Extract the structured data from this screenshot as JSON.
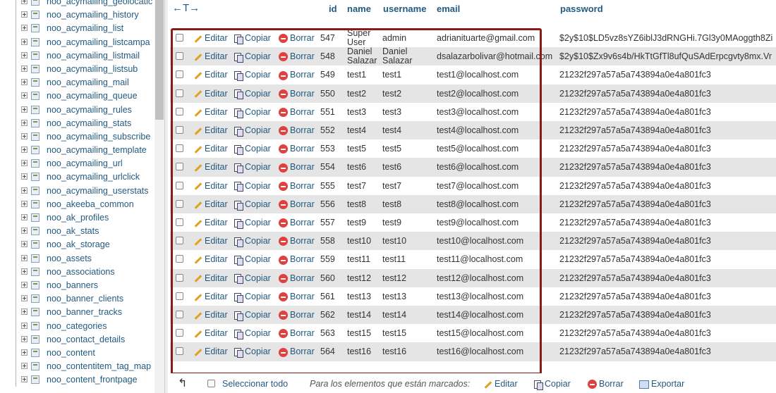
{
  "sidebar": {
    "tables": [
      "noo_acymailing_geolocatic",
      "noo_acymailing_history",
      "noo_acymailing_list",
      "noo_acymailing_listcampa",
      "noo_acymailing_listmail",
      "noo_acymailing_listsub",
      "noo_acymailing_mail",
      "noo_acymailing_queue",
      "noo_acymailing_rules",
      "noo_acymailing_stats",
      "noo_acymailing_subscribe",
      "noo_acymailing_template",
      "noo_acymailing_url",
      "noo_acymailing_urlclick",
      "noo_acymailing_userstats",
      "noo_akeeba_common",
      "noo_ak_profiles",
      "noo_ak_stats",
      "noo_ak_storage",
      "noo_assets",
      "noo_associations",
      "noo_banners",
      "noo_banner_clients",
      "noo_banner_tracks",
      "noo_categories",
      "noo_contact_details",
      "noo_content",
      "noo_contentitem_tag_map",
      "noo_content_frontpage"
    ]
  },
  "table": {
    "arrows": "←T→",
    "columns": {
      "id": "id",
      "name": "name",
      "username": "username",
      "email": "email",
      "password": "password"
    },
    "actions": {
      "edit": "Editar",
      "copy": "Copiar",
      "delete": "Borrar"
    },
    "rows": [
      {
        "id": "547",
        "name": [
          "Super",
          "User"
        ],
        "username": [
          "admin"
        ],
        "email": "adrianituarte@gmail.com",
        "password": "$2y$10$LD5vz8sYZ6iblJ3dRNGHi.7Gl3y0MAoggth8Zi"
      },
      {
        "id": "548",
        "name": [
          "Daniel",
          "Salazar"
        ],
        "username": [
          "Daniel",
          "Salazar"
        ],
        "email": "dsalazarbolivar@hotmail.com",
        "password": "$2y$10$Zx9v6s4b/HkTtGfTl8ufQuSAdErpcgvty8mx.Vr"
      },
      {
        "id": "549",
        "name": [
          "test1"
        ],
        "username": [
          "test1"
        ],
        "email": "test1@localhost.com",
        "password": "21232f297a57a5a743894a0e4a801fc3"
      },
      {
        "id": "550",
        "name": [
          "test2"
        ],
        "username": [
          "test2"
        ],
        "email": "test2@localhost.com",
        "password": "21232f297a57a5a743894a0e4a801fc3"
      },
      {
        "id": "551",
        "name": [
          "test3"
        ],
        "username": [
          "test3"
        ],
        "email": "test3@localhost.com",
        "password": "21232f297a57a5a743894a0e4a801fc3"
      },
      {
        "id": "552",
        "name": [
          "test4"
        ],
        "username": [
          "test4"
        ],
        "email": "test4@localhost.com",
        "password": "21232f297a57a5a743894a0e4a801fc3"
      },
      {
        "id": "553",
        "name": [
          "test5"
        ],
        "username": [
          "test5"
        ],
        "email": "test5@localhost.com",
        "password": "21232f297a57a5a743894a0e4a801fc3"
      },
      {
        "id": "554",
        "name": [
          "test6"
        ],
        "username": [
          "test6"
        ],
        "email": "test6@localhost.com",
        "password": "21232f297a57a5a743894a0e4a801fc3"
      },
      {
        "id": "555",
        "name": [
          "test7"
        ],
        "username": [
          "test7"
        ],
        "email": "test7@localhost.com",
        "password": "21232f297a57a5a743894a0e4a801fc3"
      },
      {
        "id": "556",
        "name": [
          "test8"
        ],
        "username": [
          "test8"
        ],
        "email": "test8@localhost.com",
        "password": "21232f297a57a5a743894a0e4a801fc3"
      },
      {
        "id": "557",
        "name": [
          "test9"
        ],
        "username": [
          "test9"
        ],
        "email": "test9@localhost.com",
        "password": "21232f297a57a5a743894a0e4a801fc3"
      },
      {
        "id": "558",
        "name": [
          "test10"
        ],
        "username": [
          "test10"
        ],
        "email": "test10@localhost.com",
        "password": "21232f297a57a5a743894a0e4a801fc3"
      },
      {
        "id": "559",
        "name": [
          "test11"
        ],
        "username": [
          "test11"
        ],
        "email": "test11@localhost.com",
        "password": "21232f297a57a5a743894a0e4a801fc3"
      },
      {
        "id": "560",
        "name": [
          "test12"
        ],
        "username": [
          "test12"
        ],
        "email": "test12@localhost.com",
        "password": "21232f297a57a5a743894a0e4a801fc3"
      },
      {
        "id": "561",
        "name": [
          "test13"
        ],
        "username": [
          "test13"
        ],
        "email": "test13@localhost.com",
        "password": "21232f297a57a5a743894a0e4a801fc3"
      },
      {
        "id": "562",
        "name": [
          "test14"
        ],
        "username": [
          "test14"
        ],
        "email": "test14@localhost.com",
        "password": "21232f297a57a5a743894a0e4a801fc3"
      },
      {
        "id": "563",
        "name": [
          "test15"
        ],
        "username": [
          "test15"
        ],
        "email": "test15@localhost.com",
        "password": "21232f297a57a5a743894a0e4a801fc3"
      },
      {
        "id": "564",
        "name": [
          "test16"
        ],
        "username": [
          "test16"
        ],
        "email": "test16@localhost.com",
        "password": "21232f297a57a5a743894a0e4a801fc3"
      }
    ]
  },
  "footer": {
    "select_all": "Seleccionar todo",
    "for_selected": "Para los elementos que están marcados:",
    "edit": "Editar",
    "copy": "Copiar",
    "delete": "Borrar",
    "export": "Exportar"
  },
  "colors": {
    "link": "#235a81",
    "row_alt": "#e5e5e5",
    "highlight_border": "#8b1a1a"
  }
}
